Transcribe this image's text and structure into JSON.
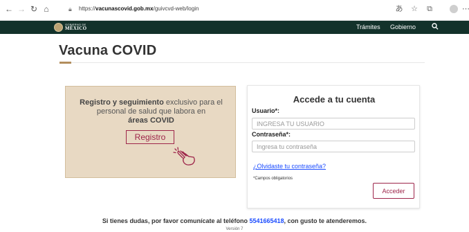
{
  "browser": {
    "url_prefix": "https://",
    "url_domain": "vacunascovid.gob.mx",
    "url_path": "/guivcvd-web/login"
  },
  "header": {
    "logo_small": "GOBIERNO DE",
    "logo_big": "MÉXICO",
    "nav": [
      "Trámites",
      "Gobierno"
    ]
  },
  "page": {
    "title": "Vacuna COVID"
  },
  "info_card": {
    "strong_1": "Registro y seguimiento",
    "text_1": " exclusivo para el personal de salud que labora en",
    "strong_2": "áreas COVID",
    "button": "Registro"
  },
  "login": {
    "title": "Accede a tu cuenta",
    "user_label": "Usuario*:",
    "user_placeholder": "INGRESA TU USUARIO",
    "password_label": "Contraseña*:",
    "password_placeholder": "Ingresa tu contraseña",
    "forgot": "¿Olvidaste tu contraseña?",
    "required_note": "*Campos obligatorios",
    "submit": "Acceder"
  },
  "footer": {
    "text_before": "Si tienes dudas, por favor comunícate al teléfono ",
    "phone": "5541665418",
    "text_after": ", con gusto te atenderemos.",
    "version": "Versión 7"
  },
  "colors": {
    "header_bg": "#13322b",
    "accent": "#9d2449",
    "gold": "#b38e5d",
    "card_bg": "#e8d9c3",
    "link": "#1b4cff"
  }
}
